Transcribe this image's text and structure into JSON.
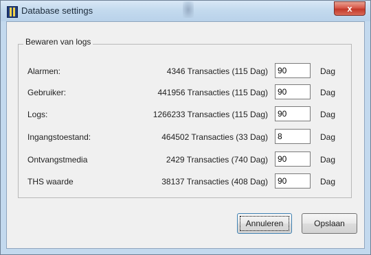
{
  "window": {
    "title": "Database settings",
    "close_label": "x"
  },
  "group": {
    "title": "Bewaren van logs"
  },
  "rows": [
    {
      "label": "Alarmen:",
      "count": "4346 Transacties (115 Dag)",
      "value": "90",
      "unit": "Dag"
    },
    {
      "label": "Gebruiker:",
      "count": "441956 Transacties (115 Dag)",
      "value": "90",
      "unit": "Dag"
    },
    {
      "label": "Logs:",
      "count": "1266233 Transacties (115 Dag)",
      "value": "90",
      "unit": "Dag"
    },
    {
      "label": "Ingangstoestand:",
      "count": "464502 Transacties (33 Dag)",
      "value": "8",
      "unit": "Dag"
    },
    {
      "label": "Ontvangstmedia",
      "count": "2429 Transacties (740 Dag)",
      "value": "90",
      "unit": "Dag"
    },
    {
      "label": "THS waarde",
      "count": "38137 Transacties (408 Dag)",
      "value": "90",
      "unit": "Dag"
    }
  ],
  "buttons": {
    "cancel": "Annuleren",
    "save": "Opslaan"
  },
  "icons": {
    "app": "database-app-icon",
    "close": "close-icon"
  }
}
